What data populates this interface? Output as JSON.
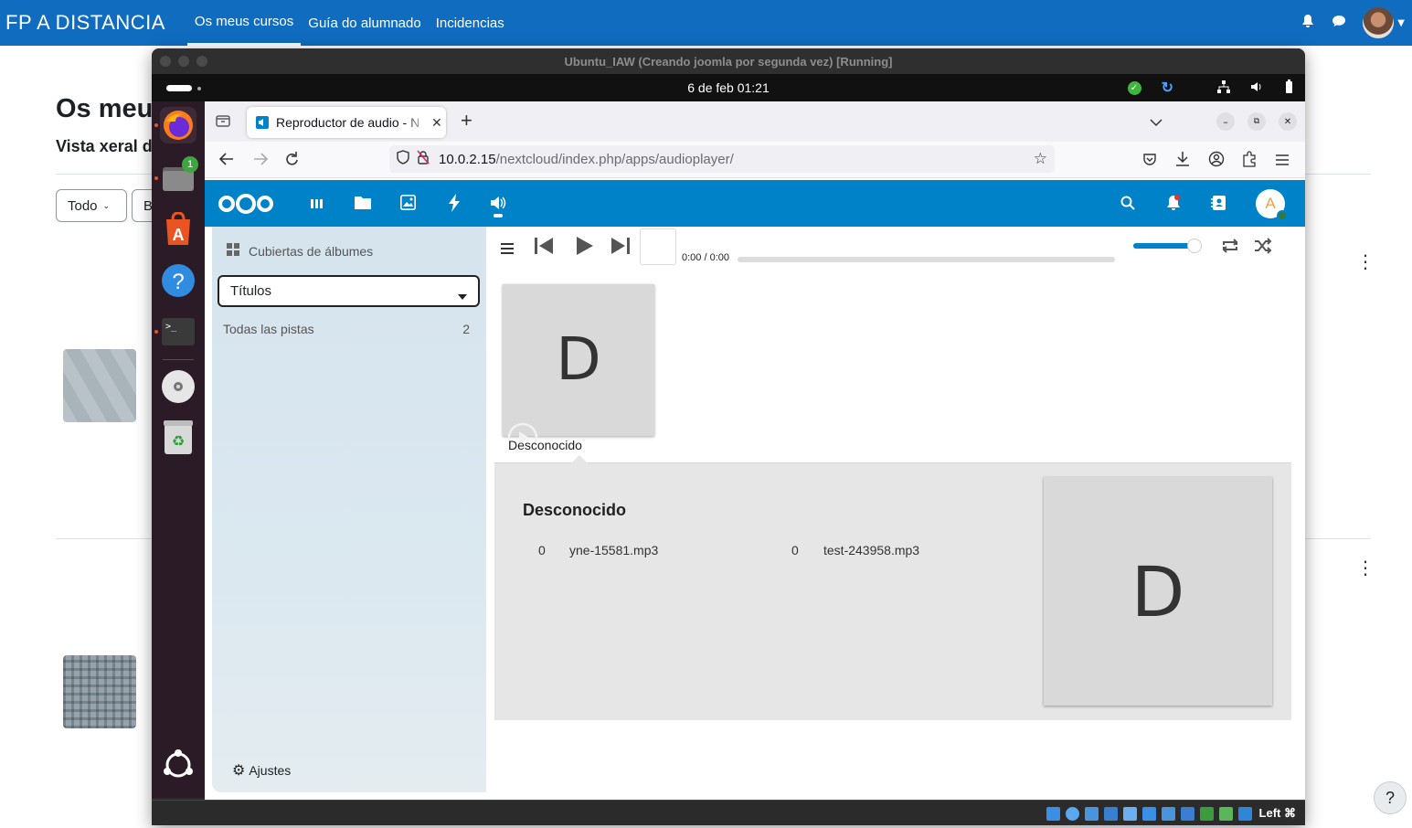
{
  "moodle": {
    "brand": "FP A DISTANCIA",
    "nav": [
      "Os meus cursos",
      "Guía do alumnado",
      "Incidencias"
    ],
    "heading": "Os meu",
    "subheading": "Vista xeral d",
    "filter_label": "Todo",
    "filter2_label": "B",
    "help": "?"
  },
  "vbox": {
    "title": "Ubuntu_IAW (Creando joomla por segunda vez) [Running]",
    "host_key": "Left ⌘"
  },
  "ubuntu": {
    "clock": "6 de feb  01:21",
    "files_badge": "1"
  },
  "firefox": {
    "tab_title": "Reproductor de audio - N",
    "url_host": "10.0.2.15",
    "url_path": "/nextcloud/index.php/apps/audioplayer/"
  },
  "nextcloud": {
    "avatar_letter": "A",
    "sidebar": {
      "view_label": "Cubiertas de álbumes",
      "category_select": "Títulos",
      "all_tracks_label": "Todas las pistas",
      "all_tracks_count": "2",
      "settings_label": "Ajustes"
    },
    "player": {
      "time": "0:00 / 0:00",
      "volume": 0.95,
      "progress": 0
    },
    "album": {
      "cover_letter": "D",
      "name": "Desconocido"
    },
    "detail": {
      "title": "Desconocido",
      "cover_letter": "D",
      "tracks": [
        {
          "num": "0",
          "name": "yne-15581.mp3"
        },
        {
          "num": "0",
          "name": "test-243958.mp3"
        }
      ]
    }
  }
}
